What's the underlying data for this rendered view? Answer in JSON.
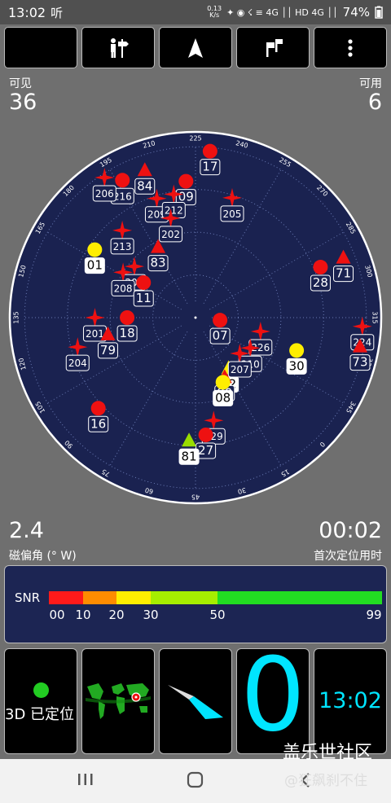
{
  "status_bar": {
    "time": "13:02",
    "time_suffix": "听",
    "net_speed_value": "0.13",
    "net_speed_unit": "K/s",
    "right_icons_text": "✦ ◉ ☇ ≡ 4G ││ HD 4G ││",
    "battery": "74%"
  },
  "toolbar": {
    "buttons": [
      {
        "name": "night-mode-button",
        "icon": "moon-icon"
      },
      {
        "name": "signpost-button",
        "icon": "signpost-icon"
      },
      {
        "name": "navigate-button",
        "icon": "arrow-icon"
      },
      {
        "name": "flags-button",
        "icon": "flags-icon"
      },
      {
        "name": "menu-button",
        "icon": "more-vert-icon"
      }
    ]
  },
  "stats": {
    "visible_label": "可见",
    "visible_value": "36",
    "used_label": "可用",
    "used_value": "6",
    "declination_value": "2.4",
    "declination_label": "磁偏角 (° W)",
    "ttff_value": "00:02",
    "ttff_label": "首次定位用时"
  },
  "sky": {
    "colors": {
      "bg": "#1a2250",
      "red": "#ee1111",
      "yellow": "#ffee00",
      "green": "#99dd00"
    },
    "heading_labels": [
      "225",
      "240",
      "255",
      "270",
      "285",
      "300",
      "315",
      "330",
      "345",
      "0",
      "15",
      "30",
      "45",
      "60",
      "75",
      "90",
      "105",
      "120",
      "135",
      "150",
      "165",
      "180",
      "195",
      "210"
    ],
    "satellites": [
      {
        "id": "17",
        "shape": "circle",
        "color": "red",
        "az": 230,
        "el": 2
      },
      {
        "id": "84",
        "shape": "triangle",
        "color": "red",
        "az": 206,
        "el": 8
      },
      {
        "id": "205",
        "shape": "star",
        "color": "red",
        "az": 242,
        "el": 24
      },
      {
        "id": "09",
        "shape": "circle",
        "color": "red",
        "az": 221,
        "el": 18
      },
      {
        "id": "209",
        "shape": "star",
        "color": "red",
        "az": 207,
        "el": 24
      },
      {
        "id": "212",
        "shape": "star",
        "color": "red",
        "az": 215,
        "el": 24
      },
      {
        "id": "216",
        "shape": "circle",
        "color": "red",
        "az": 197,
        "el": 8
      },
      {
        "id": "206",
        "shape": "star",
        "color": "red",
        "az": 192,
        "el": 2
      },
      {
        "id": "202",
        "shape": "star",
        "color": "red",
        "az": 211,
        "el": 36
      },
      {
        "id": "213",
        "shape": "star",
        "color": "red",
        "az": 185,
        "el": 30
      },
      {
        "id": "83",
        "shape": "triangle",
        "color": "red",
        "az": 197,
        "el": 48
      },
      {
        "id": "203",
        "shape": "star",
        "color": "red",
        "az": 175,
        "el": 48
      },
      {
        "id": "208",
        "shape": "star",
        "color": "red",
        "az": 167,
        "el": 45
      },
      {
        "id": "11",
        "shape": "circle",
        "color": "red",
        "az": 169,
        "el": 57
      },
      {
        "id": "01",
        "shape": "circle",
        "color": "yellow",
        "az": 169,
        "el": 26
      },
      {
        "id": "07",
        "shape": "circle",
        "color": "red",
        "az": 321,
        "el": 77
      },
      {
        "id": "226",
        "shape": "star",
        "color": "red",
        "az": 327,
        "el": 55
      },
      {
        "id": "210",
        "shape": "star",
        "color": "red",
        "az": 344,
        "el": 57
      },
      {
        "id": "30",
        "shape": "circle",
        "color": "yellow",
        "az": 333,
        "el": 34
      },
      {
        "id": "28",
        "shape": "circle",
        "color": "red",
        "az": 293,
        "el": 19
      },
      {
        "id": "71",
        "shape": "triangle",
        "color": "red",
        "az": 293,
        "el": 6
      },
      {
        "id": "224",
        "shape": "star",
        "color": "red",
        "az": 318,
        "el": 2
      },
      {
        "id": "73",
        "shape": "triangle",
        "color": "red",
        "az": 325,
        "el": 2
      },
      {
        "id": "82",
        "shape": "triangle",
        "color": "yellow",
        "az": 12,
        "el": 58
      },
      {
        "id": "80",
        "shape": "triangle",
        "color": "red",
        "az": 19,
        "el": 55
      },
      {
        "id": "08",
        "shape": "circle",
        "color": "yellow",
        "az": 22,
        "el": 53
      },
      {
        "id": "207",
        "shape": "star",
        "color": "red",
        "az": 354,
        "el": 60
      },
      {
        "id": "18",
        "shape": "circle",
        "color": "red",
        "az": 135,
        "el": 54
      },
      {
        "id": "201",
        "shape": "star",
        "color": "red",
        "az": 135,
        "el": 37
      },
      {
        "id": "79",
        "shape": "triangle",
        "color": "red",
        "az": 124,
        "el": 43
      },
      {
        "id": "204",
        "shape": "star",
        "color": "red",
        "az": 121,
        "el": 26
      },
      {
        "id": "229",
        "shape": "star",
        "color": "red",
        "az": 35,
        "el": 35
      },
      {
        "id": "27",
        "shape": "circle",
        "color": "red",
        "az": 40,
        "el": 28
      },
      {
        "id": "81",
        "shape": "triangle",
        "color": "green",
        "az": 48,
        "el": 25
      },
      {
        "id": "16",
        "shape": "circle",
        "color": "red",
        "az": 92,
        "el": 20
      }
    ]
  },
  "snr": {
    "label": "SNR",
    "ticks": [
      "00",
      "10",
      "20",
      "30",
      "50",
      "99"
    ],
    "tick_values": [
      0,
      10,
      20,
      30,
      50,
      99
    ],
    "segments": [
      {
        "from": 0,
        "to": 10,
        "color": "#ff1a1a"
      },
      {
        "from": 10,
        "to": 20,
        "color": "#ff8c00"
      },
      {
        "from": 20,
        "to": 30,
        "color": "#ffee00"
      },
      {
        "from": 30,
        "to": 50,
        "color": "#a6ee00"
      },
      {
        "from": 50,
        "to": 99,
        "color": "#22dd22"
      }
    ]
  },
  "tiles": {
    "fix_status": "3D 已定位",
    "fix_dot_color": "#22cc22",
    "map_icon": "world-map-icon",
    "compass_icon": "compass-needle-icon",
    "big_digit": "0",
    "clock": "13:02",
    "accent": "#00e5ff"
  },
  "watermark": {
    "title": "盖乐世社区",
    "user": "@狂飙刹不住"
  }
}
